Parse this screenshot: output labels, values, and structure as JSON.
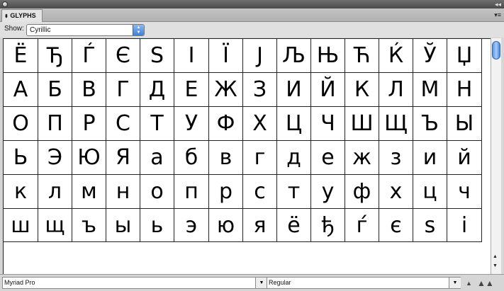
{
  "panel": {
    "tab_label": "GLYPHS",
    "tab_arrows_icon": "up-down-arrows-icon",
    "menu_icon": "panel-menu-icon"
  },
  "show": {
    "label": "Show:",
    "selected": "Cyrillic"
  },
  "glyph_rows": [
    [
      "Ё",
      "Ђ",
      "Ѓ",
      "Є",
      "S",
      "І",
      "Ї",
      "J",
      "Љ",
      "Њ",
      "Ћ",
      "Ќ",
      "Ў",
      "Џ"
    ],
    [
      "А",
      "Б",
      "В",
      "Г",
      "Д",
      "Е",
      "Ж",
      "З",
      "И",
      "Й",
      "К",
      "Л",
      "М",
      "Н"
    ],
    [
      "О",
      "П",
      "Р",
      "С",
      "Т",
      "У",
      "Ф",
      "Х",
      "Ц",
      "Ч",
      "Ш",
      "Щ",
      "Ъ",
      "Ы"
    ],
    [
      "Ь",
      "Э",
      "Ю",
      "Я",
      "а",
      "б",
      "в",
      "г",
      "д",
      "е",
      "ж",
      "з",
      "и",
      "й"
    ],
    [
      "к",
      "л",
      "м",
      "н",
      "о",
      "п",
      "р",
      "с",
      "т",
      "у",
      "ф",
      "х",
      "ц",
      "ч"
    ],
    [
      "ш",
      "щ",
      "ъ",
      "ы",
      "ь",
      "э",
      "ю",
      "я",
      "ё",
      "ђ",
      "ѓ",
      "є",
      "s",
      "і"
    ]
  ],
  "font": {
    "family": "Myriad Pro",
    "style": "Regular"
  }
}
